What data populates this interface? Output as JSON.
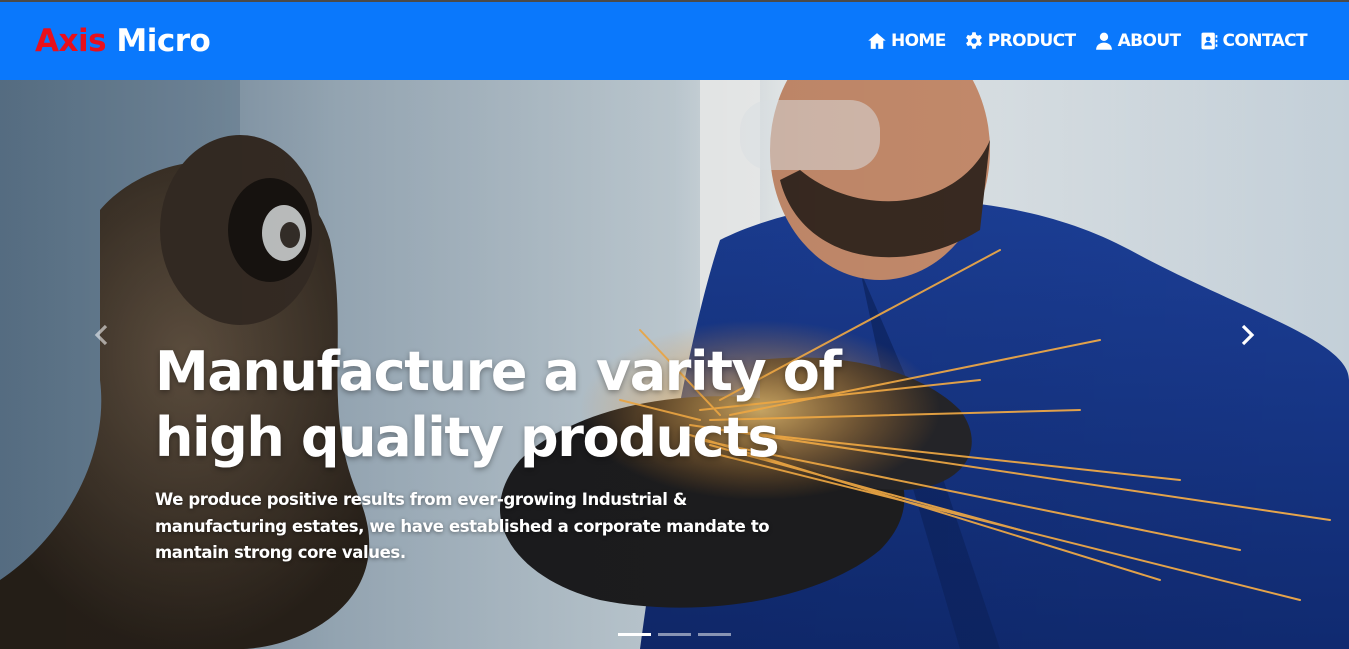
{
  "brand": {
    "part1": "Axis",
    "part2": "Micro"
  },
  "nav": {
    "items": [
      {
        "label": "HOME",
        "icon": "home-icon"
      },
      {
        "label": "PRODUCT",
        "icon": "gear-icon"
      },
      {
        "label": "ABOUT",
        "icon": "user-icon"
      },
      {
        "label": "CONTACT",
        "icon": "address-book-icon"
      }
    ]
  },
  "hero": {
    "title_line1": "Manufacture a varity of",
    "title_line2": "high quality products",
    "subtitle": "We produce positive results from ever-growing Industrial & manufacturing estates, we have established a corporate mandate to mantain strong core values.",
    "image": "photo-of-worker-grinding-metal-with-sparks",
    "slides_total": 3,
    "active_slide": 1
  },
  "colors": {
    "navbar_bg": "#0a78fc",
    "brand_accent": "#e8101c",
    "text_on_dark": "#ffffff"
  }
}
